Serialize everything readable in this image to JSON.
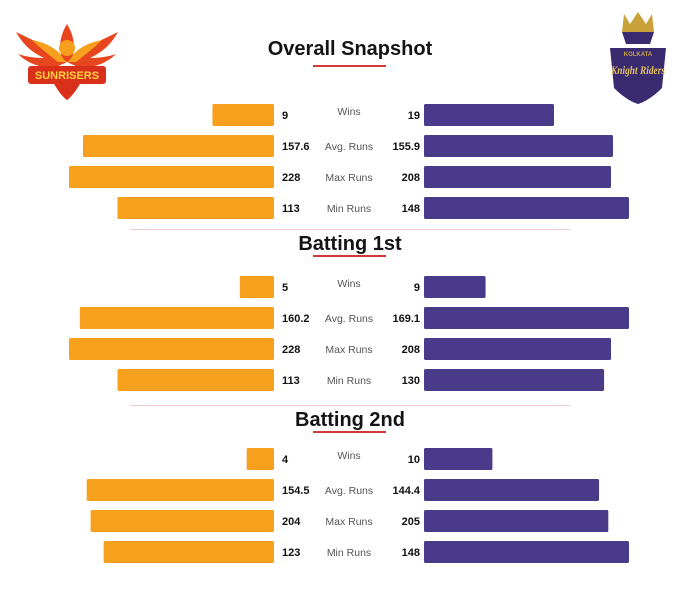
{
  "colors": {
    "srh": "#F7A01D",
    "kkr": "#4A3A8A",
    "accent": "#D23A3A",
    "divider": "#F1C9C9"
  },
  "logos": {
    "srh": {
      "icon": "sunrisers-logo",
      "text": "SUNRISERS"
    },
    "kkr": {
      "icon": "knight-riders-logo",
      "text_top": "KOLKATA",
      "text_main": "Knight Riders"
    }
  },
  "chart_data": [
    {
      "type": "bar",
      "title": "Overall Snapshot",
      "categories": [
        "Wins",
        "Avg. Runs",
        "Max Runs",
        "Min Runs"
      ],
      "series": [
        {
          "values": [
            9,
            157.6,
            228,
            113
          ]
        },
        {
          "values": [
            19,
            155.9,
            208,
            148
          ]
        }
      ]
    },
    {
      "type": "bar",
      "title": "Batting 1st",
      "categories": [
        "Wins",
        "Avg. Runs",
        "Max Runs",
        "Min Runs"
      ],
      "series": [
        {
          "values": [
            5,
            160.2,
            228,
            113
          ]
        },
        {
          "values": [
            9,
            169.1,
            208,
            130
          ]
        }
      ]
    },
    {
      "type": "bar",
      "title": "Batting 2nd",
      "categories": [
        "Wins",
        "Avg. Runs",
        "Max Runs",
        "Min Runs"
      ],
      "series": [
        {
          "values": [
            4,
            154.5,
            204,
            123
          ]
        },
        {
          "values": [
            10,
            144.4,
            205,
            148
          ]
        }
      ]
    }
  ]
}
